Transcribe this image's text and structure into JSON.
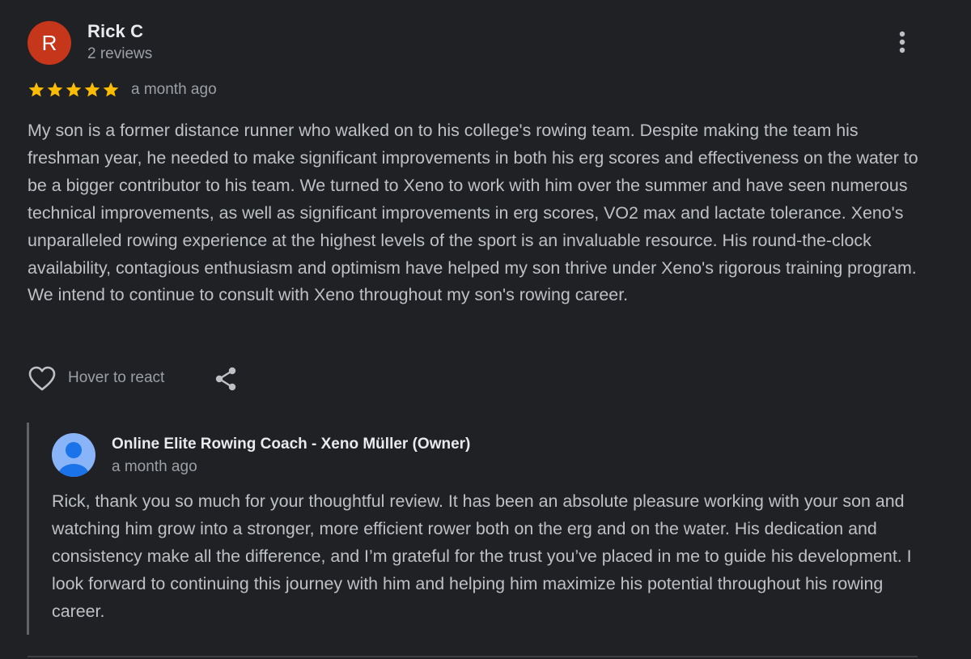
{
  "review": {
    "avatar_letter": "R",
    "avatar_color": "#c5361a",
    "reviewer_name": "Rick C",
    "review_count": "2 reviews",
    "rating": 5,
    "rating_max": 5,
    "star_color": "#fbbc04",
    "time": "a month ago",
    "text": "My son is a former distance runner who walked on to his college's rowing team. Despite making the team his freshman year, he needed to make significant improvements in both his erg scores and effectiveness on the water to be a bigger contributor to his team. We turned to Xeno to work with him over the summer and have seen numerous technical improvements, as well as significant improvements in erg scores, VO2 max and lactate tolerance. Xeno's unparalleled rowing experience at the highest levels of the sport is an invaluable resource. His round-the-clock availability, contagious enthusiasm and optimism have helped my son thrive under Xeno's rigorous training program. We intend to continue to consult with Xeno throughout my son's rowing career.",
    "more_icon": "more-vertical-icon"
  },
  "actions": {
    "like_icon": "heart-icon",
    "hover_label": "Hover to react",
    "share_icon": "share-icon"
  },
  "owner_reply": {
    "avatar_icon": "person-icon",
    "avatar_color": "#8ab4f8",
    "name": "Online Elite Rowing Coach - Xeno Müller (Owner)",
    "time": "a month ago",
    "text": "Rick, thank you so much for your thoughtful review. It has been an absolute pleasure working with your son and watching him grow into a stronger, more efficient rower both on the erg and on the water. His dedication and consistency make all the difference, and I’m grateful for the trust you’ve placed in me to guide his development. I look forward to continuing this journey with him and helping him maximize his potential throughout his rowing career."
  }
}
